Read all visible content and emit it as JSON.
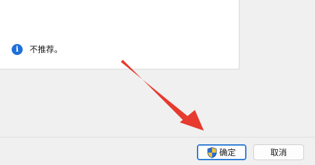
{
  "message": {
    "icon": "info-icon",
    "icon_glyph": "i",
    "text": "不推荐。"
  },
  "buttons": {
    "ok_label": "确定",
    "ok_icon": "uac-shield-icon",
    "cancel_label": "取消"
  },
  "annotation": {
    "type": "red-arrow",
    "color": "#e63b2e",
    "points_to": "ok-button"
  },
  "colors": {
    "accent": "#0a60c4",
    "info": "#1e6fd9",
    "window_bg": "#f0f0f0"
  }
}
